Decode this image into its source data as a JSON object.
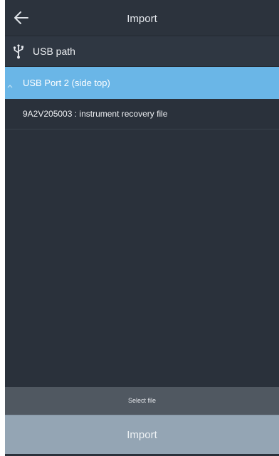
{
  "header": {
    "title": "Import",
    "back_icon": "arrow-left-icon"
  },
  "path": {
    "icon": "usb-icon",
    "label": "USB path"
  },
  "ports": [
    {
      "label": "USB Port 2 (side top)",
      "selected": true,
      "expanded": true,
      "files": [
        {
          "label": "9A2V205003 : instrument recovery file"
        }
      ]
    }
  ],
  "footer": {
    "select_label": "Select file",
    "import_label": "Import"
  },
  "colors": {
    "background": "#2a313b",
    "selected_row": "#6ab6e7",
    "select_bar": "#505861",
    "import_button": "#94a5b4"
  }
}
